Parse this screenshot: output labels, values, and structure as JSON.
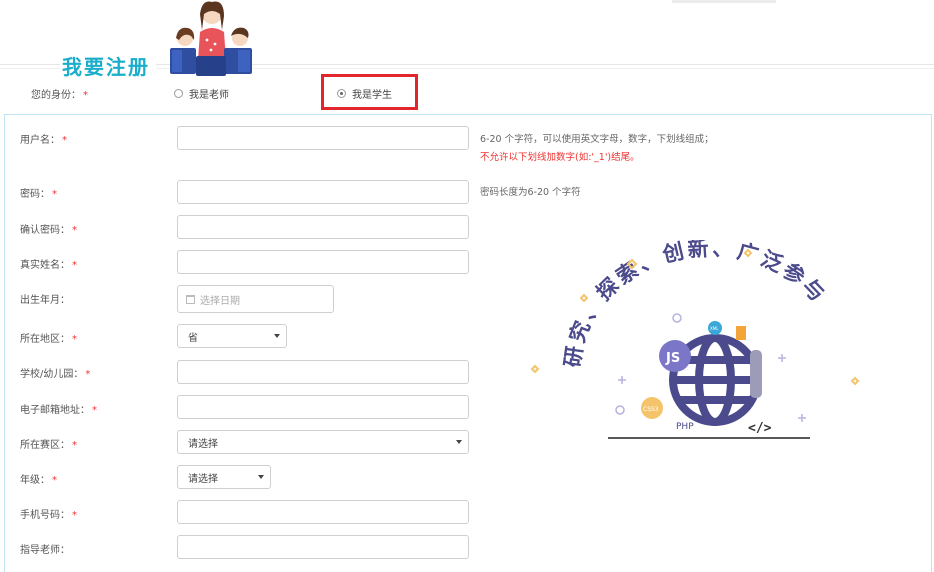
{
  "header": {
    "title": "我要注册"
  },
  "identity": {
    "label": "您的身份：",
    "required_mark": "*",
    "options": [
      {
        "label": "我是老师",
        "selected": false
      },
      {
        "label": "我是学生",
        "selected": true
      }
    ]
  },
  "form": {
    "username": {
      "label": "用户名：",
      "required": "*",
      "value": "",
      "hint_line1": "6-20 个字符，可以使用英文字母，数字，下划线组成；",
      "hint_line2": "不允许以下划线加数字(如:'_1')结尾。"
    },
    "password": {
      "label": "密码：",
      "required": "*",
      "value": "",
      "hint": "密码长度为6-20 个字符"
    },
    "confirm_password": {
      "label": "确认密码：",
      "required": "*",
      "value": ""
    },
    "real_name": {
      "label": "真实姓名：",
      "required": "*",
      "value": ""
    },
    "birth": {
      "label": "出生年月：",
      "placeholder": "选择日期"
    },
    "region": {
      "label": "所在地区：",
      "required": "*",
      "selected": "省"
    },
    "school": {
      "label": "学校/幼儿园：",
      "required": "*",
      "value": ""
    },
    "email": {
      "label": "电子邮箱地址：",
      "required": "*",
      "value": ""
    },
    "competition_area": {
      "label": "所在赛区：",
      "required": "*",
      "selected": "请选择"
    },
    "grade": {
      "label": "年级：",
      "required": "*",
      "selected": "请选择"
    },
    "phone": {
      "label": "手机号码：",
      "required": "*",
      "value": ""
    },
    "teacher": {
      "label": "指导老师：",
      "value": ""
    }
  },
  "illustration": {
    "slogan": "研究、探索、创新、广泛参与",
    "badges": [
      "JS",
      "CSS3",
      "PHP",
      "XML",
      "</>"
    ]
  },
  "colors": {
    "accent": "#1aaecb",
    "required": "#e33333",
    "highlight": "#e3262b",
    "globe": "#4b4a8c"
  }
}
